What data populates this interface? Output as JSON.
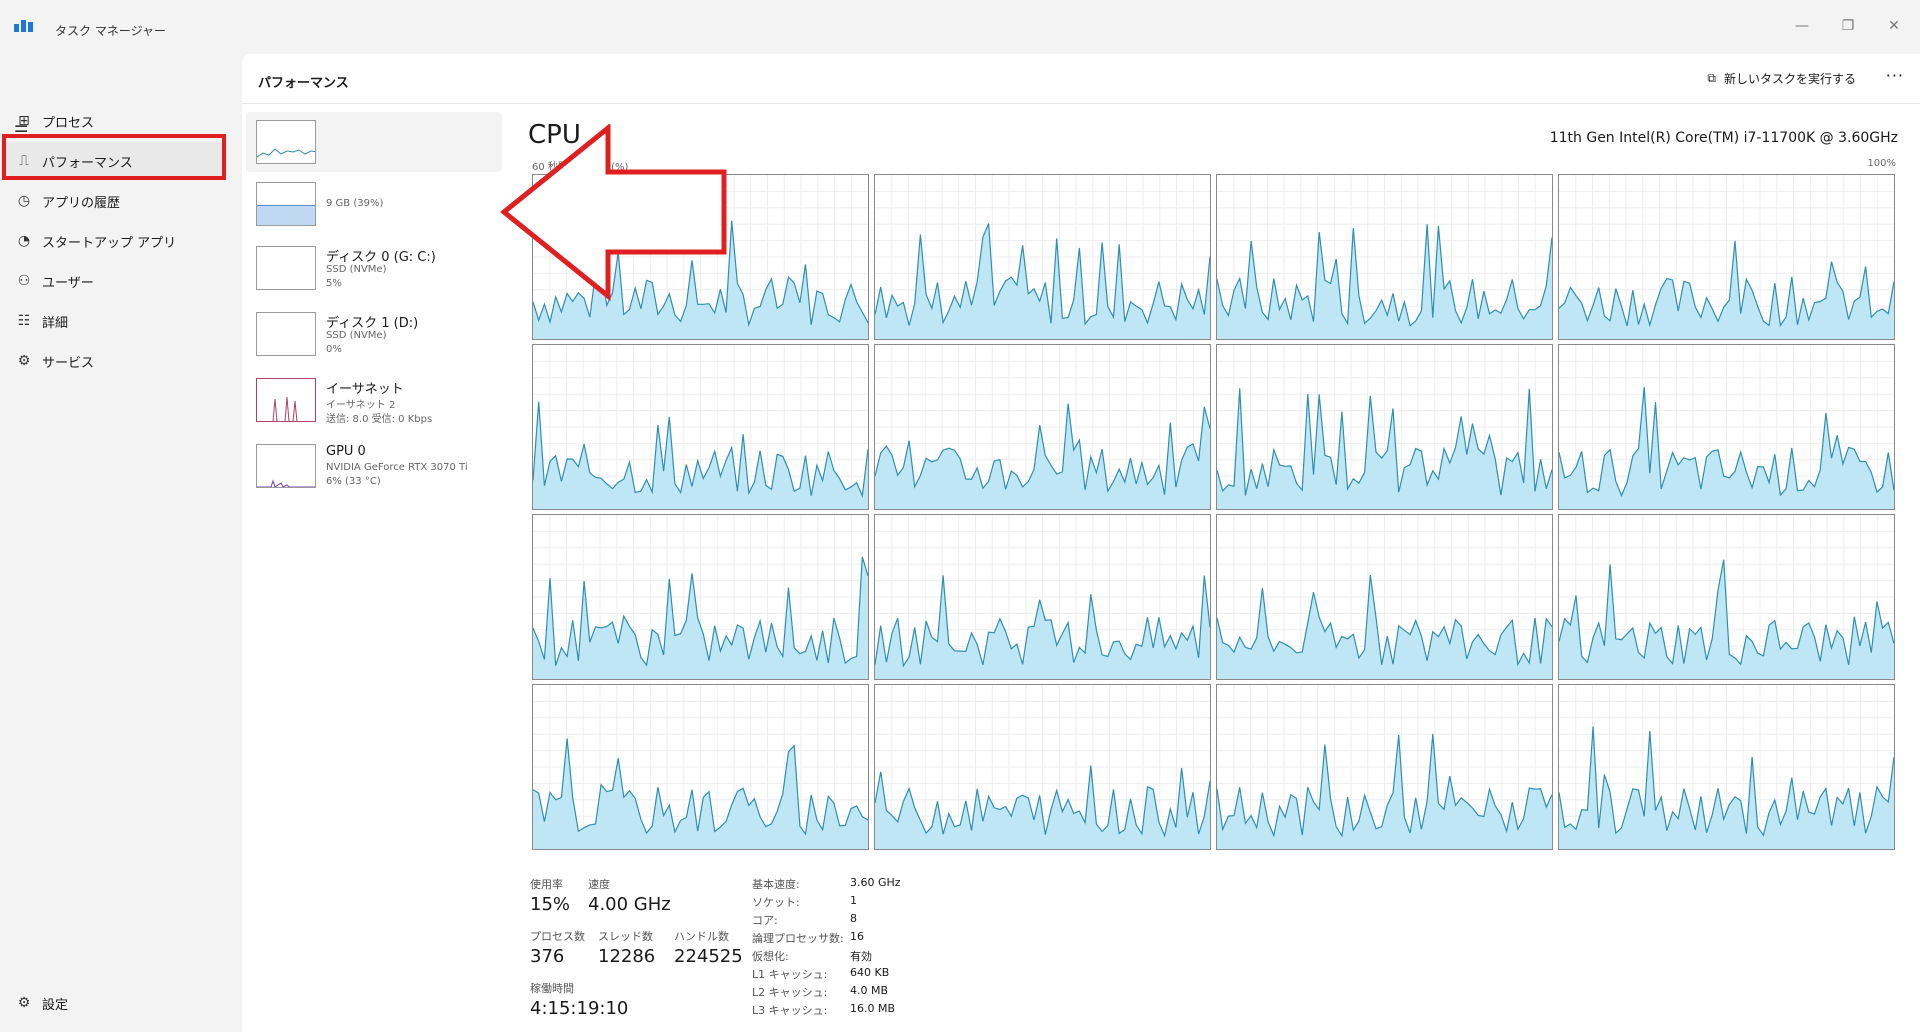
{
  "app": {
    "title": "タスク マネージャー",
    "window_controls": [
      "—",
      "❐",
      "✕"
    ]
  },
  "sidebar": {
    "items": [
      {
        "label": "プロセス",
        "icon": "processes-icon"
      },
      {
        "label": "パフォーマンス",
        "icon": "performance-icon"
      },
      {
        "label": "アプリの履歴",
        "icon": "app-history-icon"
      },
      {
        "label": "スタートアップ アプリ",
        "icon": "startup-icon"
      },
      {
        "label": "ユーザー",
        "icon": "users-icon"
      },
      {
        "label": "詳細",
        "icon": "details-icon"
      },
      {
        "label": "サービス",
        "icon": "services-icon"
      }
    ],
    "settings_label": "設定"
  },
  "header": {
    "title": "パフォーマンス",
    "run_task_label": "新しいタスクを実行する",
    "more_label": "···"
  },
  "devices": [
    {
      "name": "",
      "sub1": "",
      "sub2": ""
    },
    {
      "name": "",
      "sub1": "",
      "sub2": "9 GB (39%)"
    },
    {
      "name": "ディスク 0 (G: C:)",
      "sub1": "SSD (NVMe)",
      "sub2": "5%"
    },
    {
      "name": "ディスク 1 (D:)",
      "sub1": "SSD (NVMe)",
      "sub2": "0%"
    },
    {
      "name": "イーサネット",
      "sub1": "イーサネット 2",
      "sub2": "送信: 8.0 受信: 0 Kbps"
    },
    {
      "name": "GPU 0",
      "sub1": "NVIDIA GeForce RTX 3070 Ti",
      "sub2": "6% (33 °C)"
    }
  ],
  "cpu": {
    "title": "CPU",
    "model": "11th Gen Intel(R) Core(TM) i7-11700K @ 3.60GHz",
    "axis_left": "60 秒間の使用率 (%)",
    "axis_right": "100%",
    "stats": {
      "usage_label": "使用率",
      "usage": "15%",
      "speed_label": "速度",
      "speed": "4.00 GHz",
      "processes_label": "プロセス数",
      "processes": "376",
      "threads_label": "スレッド数",
      "threads": "12286",
      "handles_label": "ハンドル数",
      "handles": "224525",
      "uptime_label": "稼働時間",
      "uptime": "4:15:19:10"
    },
    "specs": [
      {
        "k": "基本速度:",
        "v": "3.60 GHz"
      },
      {
        "k": "ソケット:",
        "v": "1"
      },
      {
        "k": "コア:",
        "v": "8"
      },
      {
        "k": "論理プロセッサ数:",
        "v": "16"
      },
      {
        "k": "仮想化:",
        "v": "有効"
      },
      {
        "k": "L1 キャッシュ:",
        "v": "640 KB"
      },
      {
        "k": "L2 キャッシュ:",
        "v": "4.0 MB"
      },
      {
        "k": "L3 キャッシュ:",
        "v": "16.0 MB"
      }
    ]
  },
  "colors": {
    "accent": "#2e8fb0",
    "fill": "#bfe6f5",
    "highlight": "#e02020"
  }
}
